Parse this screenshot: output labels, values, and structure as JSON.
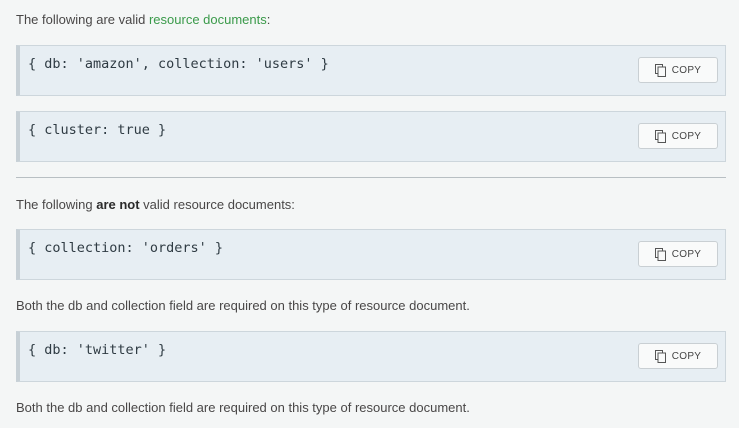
{
  "intro_valid": {
    "before": "The following are valid ",
    "link": "resource documents",
    "after": ":"
  },
  "intro_invalid": {
    "before": "The following ",
    "strong": "are not",
    "after": " valid resource documents:"
  },
  "code_blocks": [
    {
      "code": "{ db: 'amazon', collection: 'users' }",
      "copy_label": "COPY"
    },
    {
      "code": "{ cluster: true }",
      "copy_label": "COPY"
    },
    {
      "code": "{ collection: 'orders' }",
      "copy_label": "COPY"
    },
    {
      "code": "{ db: 'twitter' }",
      "copy_label": "COPY"
    }
  ],
  "notes": [
    "Both the db and collection field are required on this type of resource document.",
    "Both the db and collection field are required on this type of resource document."
  ],
  "icons": {
    "copy": "copy-icon"
  }
}
